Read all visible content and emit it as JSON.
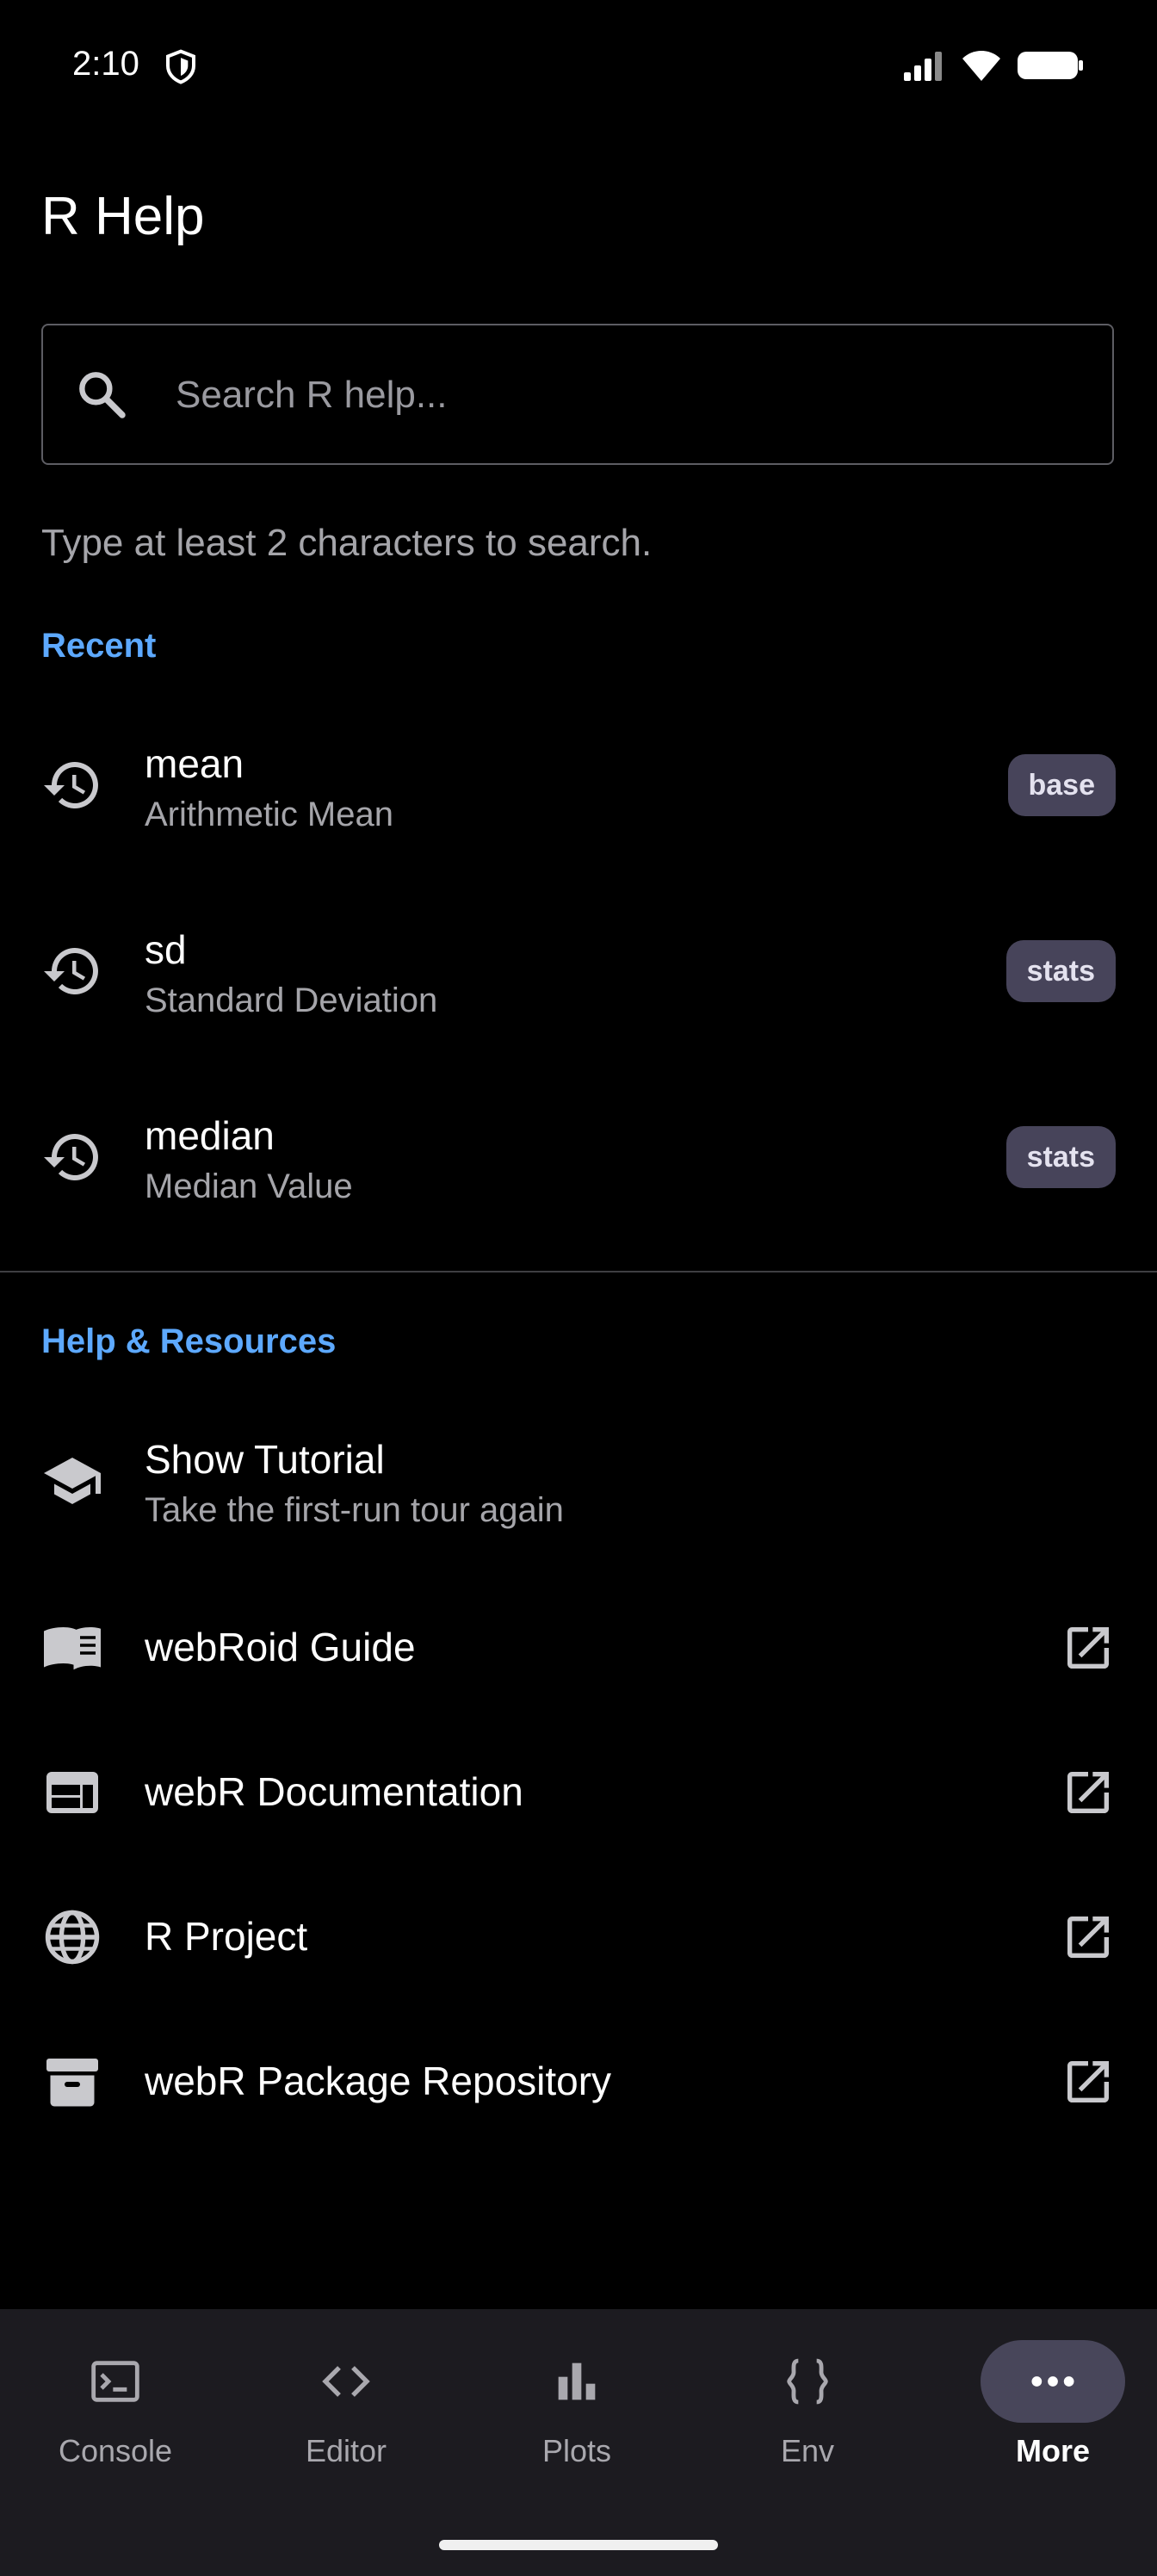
{
  "status_bar": {
    "time": "2:10"
  },
  "title": "R Help",
  "search": {
    "placeholder": "Search R help...",
    "value": "",
    "hint": "Type at least 2 characters to search."
  },
  "recent": {
    "heading": "Recent",
    "items": [
      {
        "name": "mean",
        "desc": "Arithmetic Mean",
        "pkg": "base"
      },
      {
        "name": "sd",
        "desc": "Standard Deviation",
        "pkg": "stats"
      },
      {
        "name": "median",
        "desc": "Median Value",
        "pkg": "stats"
      }
    ]
  },
  "resources": {
    "heading": "Help & Resources",
    "tutorial": {
      "title": "Show Tutorial",
      "desc": "Take the first-run tour again"
    },
    "links": [
      {
        "label": "webRoid Guide",
        "icon": "book-icon"
      },
      {
        "label": "webR Documentation",
        "icon": "web-page-icon"
      },
      {
        "label": "R Project",
        "icon": "globe-icon"
      },
      {
        "label": "webR Package Repository",
        "icon": "archive-icon"
      }
    ]
  },
  "nav": {
    "items": [
      {
        "label": "Console",
        "icon": "terminal-icon"
      },
      {
        "label": "Editor",
        "icon": "code-icon"
      },
      {
        "label": "Plots",
        "icon": "bar-chart-icon"
      },
      {
        "label": "Env",
        "icon": "braces-icon"
      },
      {
        "label": "More",
        "icon": "more-dots-icon",
        "active": true
      }
    ]
  },
  "colors": {
    "accent": "#5da9ff",
    "badge_bg": "#47445a",
    "nav_bg": "#1c1b20",
    "active_pill": "#48465a"
  }
}
